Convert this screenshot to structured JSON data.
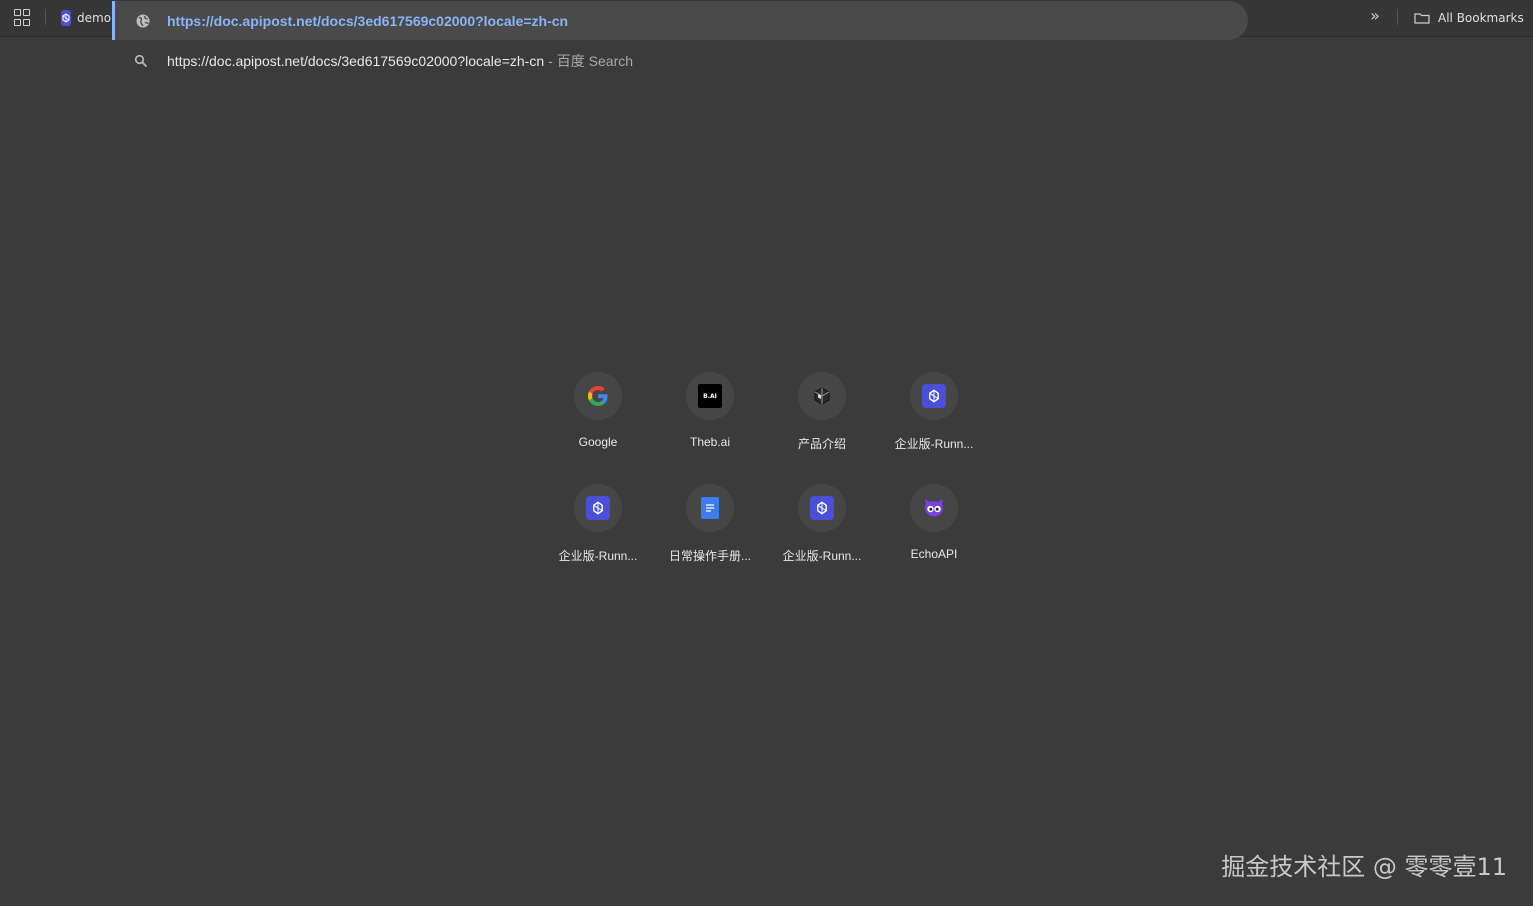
{
  "bookmarks_bar": {
    "tab_label": "demo",
    "more_icon": "double-chevron-right-icon",
    "all_bookmarks_label": "All Bookmarks"
  },
  "omnibox": {
    "url_value": "https://doc.apipost.net/docs/3ed617569c02000?locale=zh-cn",
    "icon": "globe-icon"
  },
  "suggestion": {
    "text": "https://doc.apipost.net/docs/3ed617569c02000?locale=zh-cn",
    "separator": "-",
    "engine": "百度 Search",
    "icon": "search-icon"
  },
  "shortcuts": [
    {
      "label": "Google",
      "icon": "google-icon"
    },
    {
      "label": "Theb.ai",
      "icon": "theb-ai-icon",
      "badge": "B.AI"
    },
    {
      "label": "产品介绍",
      "icon": "cube-icon"
    },
    {
      "label": "企业版-Runn...",
      "icon": "apipost-icon"
    },
    {
      "label": "企业版-Runn...",
      "icon": "apipost-icon"
    },
    {
      "label": "日常操作手册...",
      "icon": "docs-icon"
    },
    {
      "label": "企业版-Runn...",
      "icon": "apipost-icon"
    },
    {
      "label": "EchoAPI",
      "icon": "echoapi-owl-icon"
    }
  ],
  "watermark": "掘金技术社区 @ 零零壹11",
  "colors": {
    "accent": "#8ab4f8",
    "background": "#3b3b3b",
    "apipost": "#4b4fd8"
  }
}
